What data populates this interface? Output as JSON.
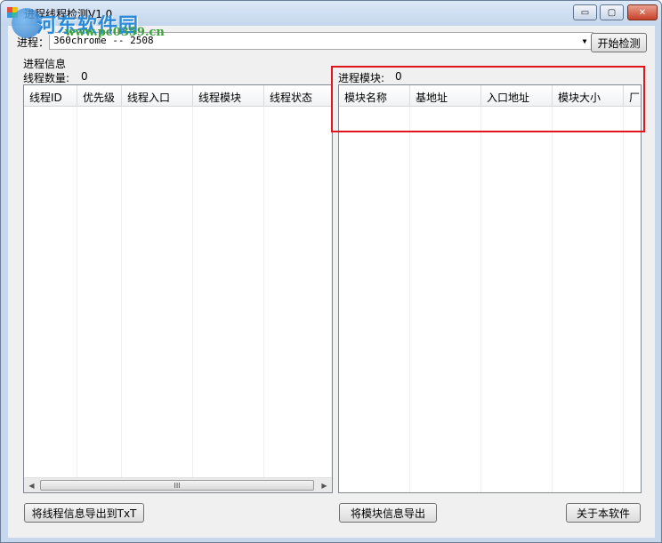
{
  "window": {
    "title": "进程线程检测V1.0",
    "controls": {
      "minimize": "▭",
      "maximize": "▢",
      "close": "✕"
    }
  },
  "watermark": {
    "name": "河东软件园",
    "url": "www.pc0359.cn"
  },
  "process_selector": {
    "label": "进程：",
    "value": "360chrome -- 2508",
    "start_button": "开始检测"
  },
  "thread_panel": {
    "group_label": "进程信息",
    "count_label": "线程数量:",
    "count_value": "0",
    "columns": [
      "线程ID",
      "优先级",
      "线程入口",
      "线程模块",
      "线程状态"
    ],
    "scroll_thumb": "III",
    "export_button": "将线程信息导出到TxT"
  },
  "module_panel": {
    "title_label": "进程模块:",
    "count_value": "0",
    "columns": [
      "模块名称",
      "基地址",
      "入口地址",
      "模块大小",
      "厂"
    ],
    "export_button": "将模块信息导出"
  },
  "about_button": "关于本软件",
  "colors": {
    "highlight_border": "#e0161c",
    "watermark_blue": "#2a8ad8",
    "watermark_green": "#3ba23b"
  }
}
